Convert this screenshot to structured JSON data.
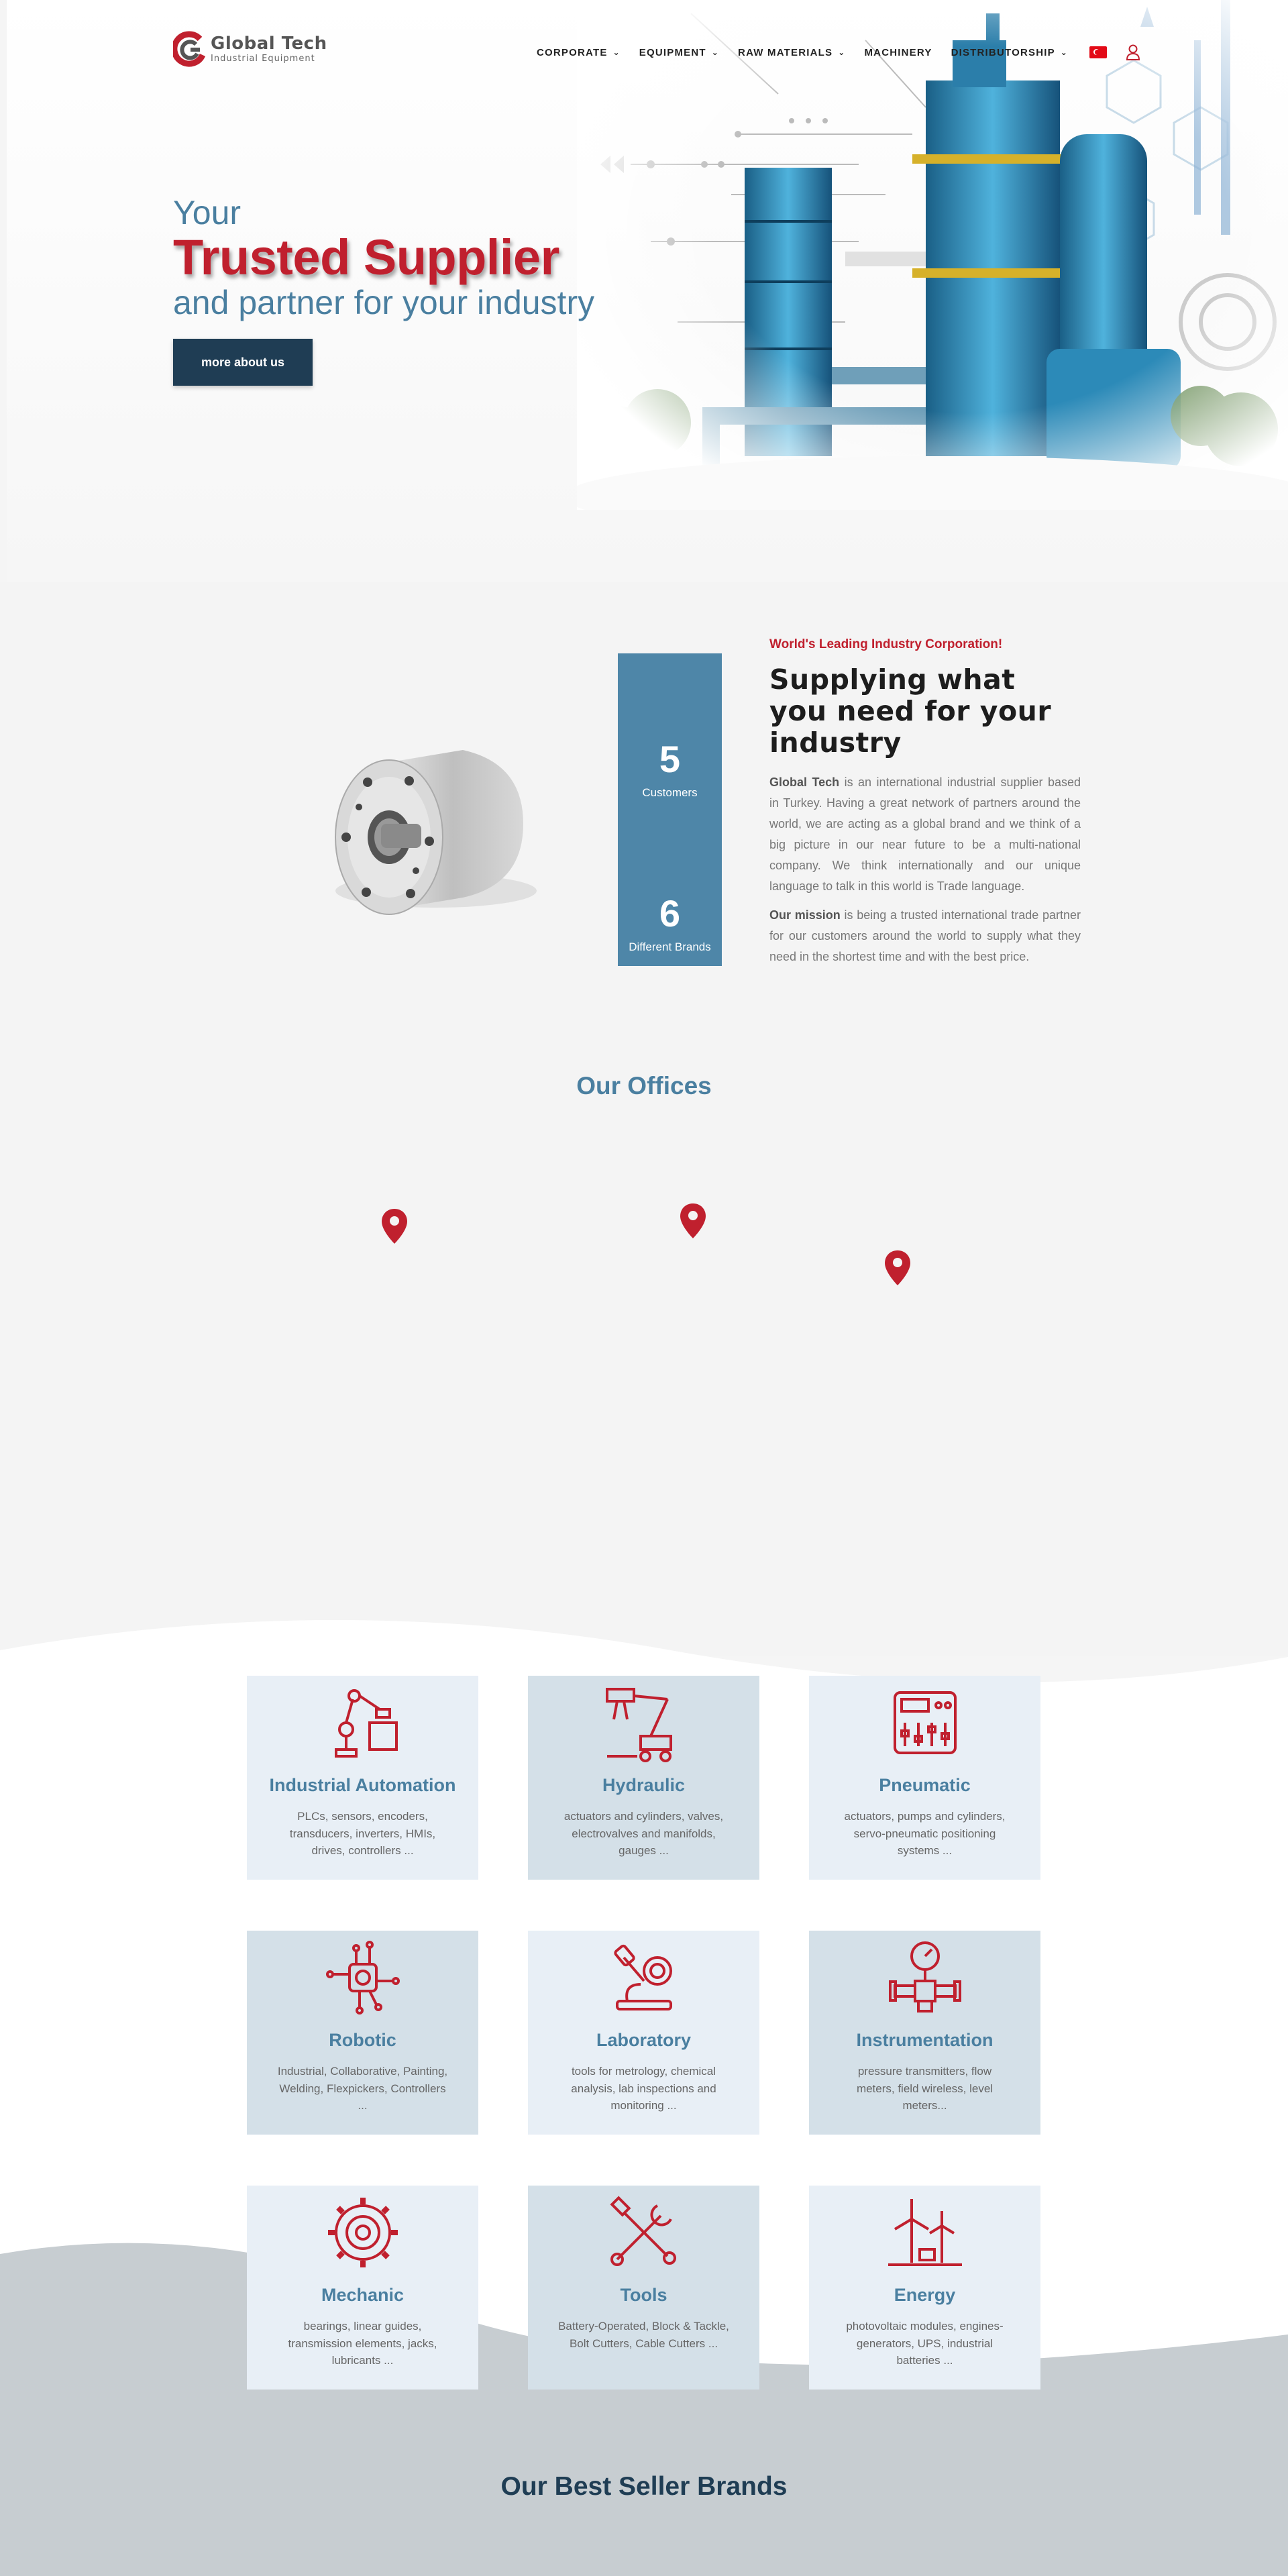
{
  "brand": {
    "name": "Global Tech",
    "tagline": "Industrial Equipment"
  },
  "nav": {
    "items": [
      {
        "label": "CORPORATE",
        "dropdown": true
      },
      {
        "label": "EQUIPMENT",
        "dropdown": true
      },
      {
        "label": "RAW MATERIALS",
        "dropdown": true
      },
      {
        "label": "MACHINERY",
        "dropdown": false
      },
      {
        "label": "DISTRIBUTORSHIP",
        "dropdown": true
      }
    ],
    "language_icon": "turkey-flag-icon",
    "account_icon": "user-icon"
  },
  "hero": {
    "line1": "Your",
    "line2": "Trusted Supplier",
    "line3": "and partner for your industry",
    "cta": "more about us"
  },
  "about": {
    "stats": [
      {
        "value": "5",
        "label": "Customers"
      },
      {
        "value": "6",
        "label": "Different Brands"
      }
    ],
    "eyebrow": "World's Leading Industry Corporation!",
    "title": "Supplying what you need for your industry",
    "p1_strong": "Global Tech",
    "p1_rest": " is an international industrial supplier based in Turkey. Having a great network of partners around the world, we are acting as a global brand and we think of a big picture in our near future to be a multi-national company. We think internationally and our unique language to talk in this world is Trade language.",
    "p2_strong": "Our mission",
    "p2_rest": " is being a trusted international trade partner for our customers around the world to supply what they need in the shortest time and with the best price."
  },
  "offices": {
    "title": "Our Offices"
  },
  "categories": [
    {
      "title": "Industrial Automation",
      "desc": "PLCs, sensors, encoders, transducers, inverters, HMIs, drives, controllers ...",
      "icon": "robot-arm-icon"
    },
    {
      "title": "Hydraulic",
      "desc": "actuators and cylinders, valves, electrovalves and manifolds, gauges ...",
      "icon": "excavator-arm-icon"
    },
    {
      "title": "Pneumatic",
      "desc": "actuators, pumps and cylinders, servo-pneumatic positioning systems ...",
      "icon": "control-panel-icon"
    },
    {
      "title": "Robotic",
      "desc": "Industrial, Collaborative, Painting, Welding, Flexpickers, Controllers ...",
      "icon": "circuit-brain-icon"
    },
    {
      "title": "Laboratory",
      "desc": "tools for metrology, chemical analysis, lab inspections and monitoring ...",
      "icon": "microscope-icon"
    },
    {
      "title": "Instrumentation",
      "desc": "pressure transmitters, flow meters, field wireless, level meters...",
      "icon": "pressure-gauge-icon"
    },
    {
      "title": "Mechanic",
      "desc": "bearings, linear guides, transmission elements, jacks, lubricants ...",
      "icon": "gear-icon"
    },
    {
      "title": "Tools",
      "desc": "Battery-Operated, Block & Tackle, Bolt Cutters, Cable Cutters ...",
      "icon": "wrench-screwdriver-icon"
    },
    {
      "title": "Energy",
      "desc": "photovoltaic modules, engines-generators, UPS, industrial batteries ...",
      "icon": "wind-solar-icon"
    }
  ],
  "brands": {
    "title": "Our Best Seller Brands"
  },
  "colors": {
    "accent_red": "#c0202e",
    "steel_blue": "#4a7fa0",
    "navy": "#1f3d54",
    "stat_blue": "#4e86a8"
  }
}
